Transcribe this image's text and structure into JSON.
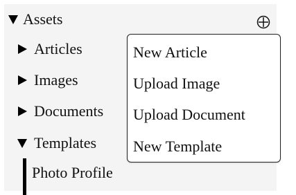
{
  "tree": {
    "root": {
      "label": "Assets",
      "expanded": true
    },
    "add_icon": "circled-plus-icon",
    "items": [
      {
        "label": "Articles",
        "expanded": false
      },
      {
        "label": "Images",
        "expanded": false
      },
      {
        "label": "Documents",
        "expanded": false
      },
      {
        "label": "Templates",
        "expanded": true
      }
    ],
    "templates_children": [
      "Photo Profile"
    ]
  },
  "context_menu": {
    "items": [
      {
        "label": "New Article"
      },
      {
        "label": "Upload Image"
      },
      {
        "label": "Upload Document"
      },
      {
        "label": "New Template"
      }
    ]
  }
}
